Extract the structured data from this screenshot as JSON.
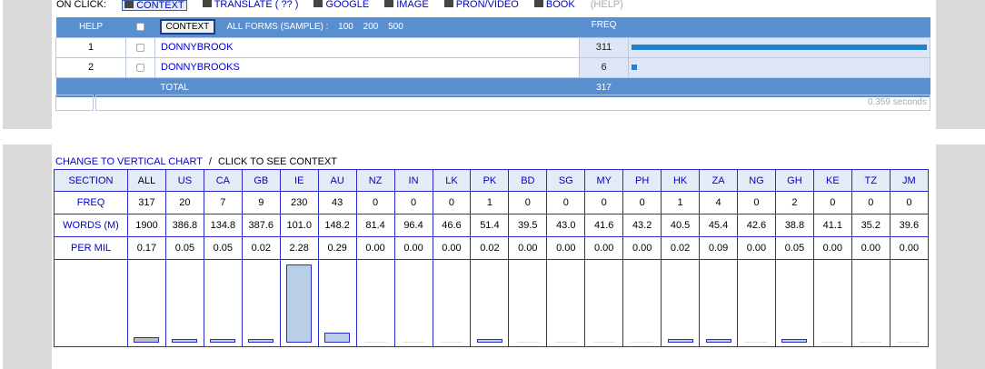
{
  "top_bar": {
    "label": "ON CLICK:",
    "options": [
      {
        "label": "CONTEXT",
        "icon": "document-icon",
        "selected": true
      },
      {
        "label": "TRANSLATE  ( ?? )",
        "icon": "translate-icon"
      },
      {
        "label": "GOOGLE",
        "icon": "google-icon"
      },
      {
        "label": "IMAGE",
        "icon": "image-icon"
      },
      {
        "label": "PRON/VIDEO",
        "icon": "video-icon"
      },
      {
        "label": "BOOK",
        "icon": "book-icon"
      }
    ],
    "help": "(HELP)"
  },
  "freq_table": {
    "help_label": "HELP",
    "context_button": "CONTEXT",
    "all_forms_label": "ALL FORMS (SAMPLE) :",
    "sample_sizes": [
      "100",
      "200",
      "500"
    ],
    "freq_label": "FREQ",
    "rows": [
      {
        "num": "1",
        "word": "DONNYBROOK",
        "freq": "311",
        "bar_fraction": 1.0
      },
      {
        "num": "2",
        "word": "DONNYBROOKS",
        "freq": "6",
        "bar_fraction": 0.019
      }
    ],
    "total_label": "TOTAL",
    "total_value": "317"
  },
  "timing": "0.359 seconds",
  "chart_header": {
    "link": "CHANGE TO VERTICAL CHART",
    "separator": "/",
    "hint": "CLICK TO SEE CONTEXT"
  },
  "chart_data": {
    "type": "table",
    "row_labels": {
      "section": "SECTION",
      "freq": "FREQ",
      "words": "WORDS (M)",
      "permil": "PER MIL"
    },
    "columns": [
      {
        "section": "ALL",
        "freq": "317",
        "words": "1900",
        "permil": "0.17"
      },
      {
        "section": "US",
        "freq": "20",
        "words": "386.8",
        "permil": "0.05"
      },
      {
        "section": "CA",
        "freq": "7",
        "words": "134.8",
        "permil": "0.05"
      },
      {
        "section": "GB",
        "freq": "9",
        "words": "387.6",
        "permil": "0.02"
      },
      {
        "section": "IE",
        "freq": "230",
        "words": "101.0",
        "permil": "2.28"
      },
      {
        "section": "AU",
        "freq": "43",
        "words": "148.2",
        "permil": "0.29"
      },
      {
        "section": "NZ",
        "freq": "0",
        "words": "81.4",
        "permil": "0.00"
      },
      {
        "section": "IN",
        "freq": "0",
        "words": "96.4",
        "permil": "0.00"
      },
      {
        "section": "LK",
        "freq": "0",
        "words": "46.6",
        "permil": "0.00"
      },
      {
        "section": "PK",
        "freq": "1",
        "words": "51.4",
        "permil": "0.02"
      },
      {
        "section": "BD",
        "freq": "0",
        "words": "39.5",
        "permil": "0.00"
      },
      {
        "section": "SG",
        "freq": "0",
        "words": "43.0",
        "permil": "0.00"
      },
      {
        "section": "MY",
        "freq": "0",
        "words": "41.6",
        "permil": "0.00"
      },
      {
        "section": "PH",
        "freq": "0",
        "words": "43.2",
        "permil": "0.00"
      },
      {
        "section": "HK",
        "freq": "1",
        "words": "40.5",
        "permil": "0.02"
      },
      {
        "section": "ZA",
        "freq": "4",
        "words": "45.4",
        "permil": "0.09"
      },
      {
        "section": "NG",
        "freq": "0",
        "words": "42.6",
        "permil": "0.00"
      },
      {
        "section": "GH",
        "freq": "2",
        "words": "38.8",
        "permil": "0.05"
      },
      {
        "section": "KE",
        "freq": "0",
        "words": "41.1",
        "permil": "0.00"
      },
      {
        "section": "TZ",
        "freq": "0",
        "words": "35.2",
        "permil": "0.00"
      },
      {
        "section": "JM",
        "freq": "0",
        "words": "39.6",
        "permil": "0.00"
      }
    ]
  }
}
